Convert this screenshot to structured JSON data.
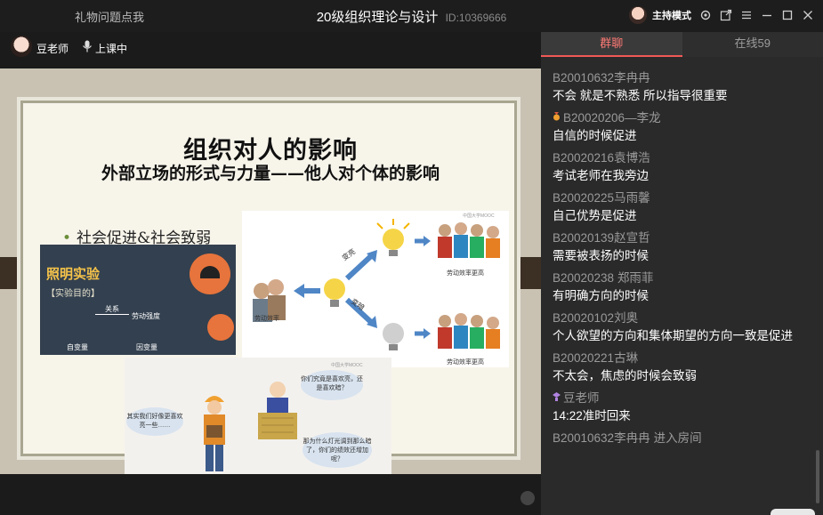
{
  "titlebar": {
    "left_link": "礼物问题点我",
    "course_title": "20级组织理论与设计",
    "room_id": "ID:10369666",
    "host_mode": "主持模式",
    "icons": [
      "settings-icon",
      "popout-icon",
      "menu-icon",
      "minimize-icon",
      "maximize-icon",
      "close-icon"
    ]
  },
  "teacher": {
    "name": "豆老师",
    "status": "上课中"
  },
  "slide": {
    "title": "组织对人的影响",
    "subtitle": "外部立场的形式与力量——他人对个体的影响",
    "bullet": "社会促进&社会致弱",
    "experiment": {
      "title": "照明实验",
      "purpose": "【实验目的】",
      "relation": "关系",
      "intensity": "劳动强度",
      "independent": "自变量",
      "dependent": "因变量"
    },
    "diagram": {
      "bright": "变亮",
      "dark": "变暗",
      "efficiency_up_top": "劳动效率更高",
      "efficiency_up_bottom": "劳动效率更高",
      "efficiency_left": "劳动效率",
      "logo": "中国大学MOOC"
    },
    "cartoon": {
      "bubble_worker": "其实我们好像更喜欢亮一些……",
      "bubble_boss_top": "你们究竟是喜欢亮，还是喜欢暗？",
      "bubble_boss_bottom": "那为什么灯光调到那么暗了，你们的绩效还增加呢？",
      "logo": "中国大学MOOC"
    }
  },
  "chat": {
    "tabs": [
      {
        "label": "群聊",
        "active": true
      },
      {
        "label": "在线59",
        "active": false
      }
    ],
    "messages": [
      {
        "name": "B20010632李冉冉",
        "text": "不会 就是不熟悉 所以指导很重要",
        "badge": ""
      },
      {
        "name": "B20020206—李龙",
        "text": "自信的时候促进",
        "badge": "medal"
      },
      {
        "name": "B20020216袁博浩",
        "text": "考试老师在我旁边",
        "badge": ""
      },
      {
        "name": "B20020225马雨馨",
        "text": "自己优势是促进",
        "badge": ""
      },
      {
        "name": "B20020139赵宣哲",
        "text": "需要被表扬的时候",
        "badge": ""
      },
      {
        "name": "B20020238 郑雨菲",
        "text": "有明确方向的时候",
        "badge": ""
      },
      {
        "name": "B20020102刘奥",
        "text": "个人欲望的方向和集体期望的方向一致是促进",
        "badge": ""
      },
      {
        "name": "B20020221古琳",
        "text": "不太会，焦虑的时候会致弱",
        "badge": ""
      },
      {
        "name": "豆老师",
        "text": "14:22准时回来",
        "badge": "teacher"
      }
    ],
    "system": {
      "name": "B20010632李冉冉",
      "event": "进入房间"
    }
  },
  "colors": {
    "accent": "#f05a55",
    "panel_bg": "#2a2a2a",
    "app_bg": "#1b1b1b"
  }
}
